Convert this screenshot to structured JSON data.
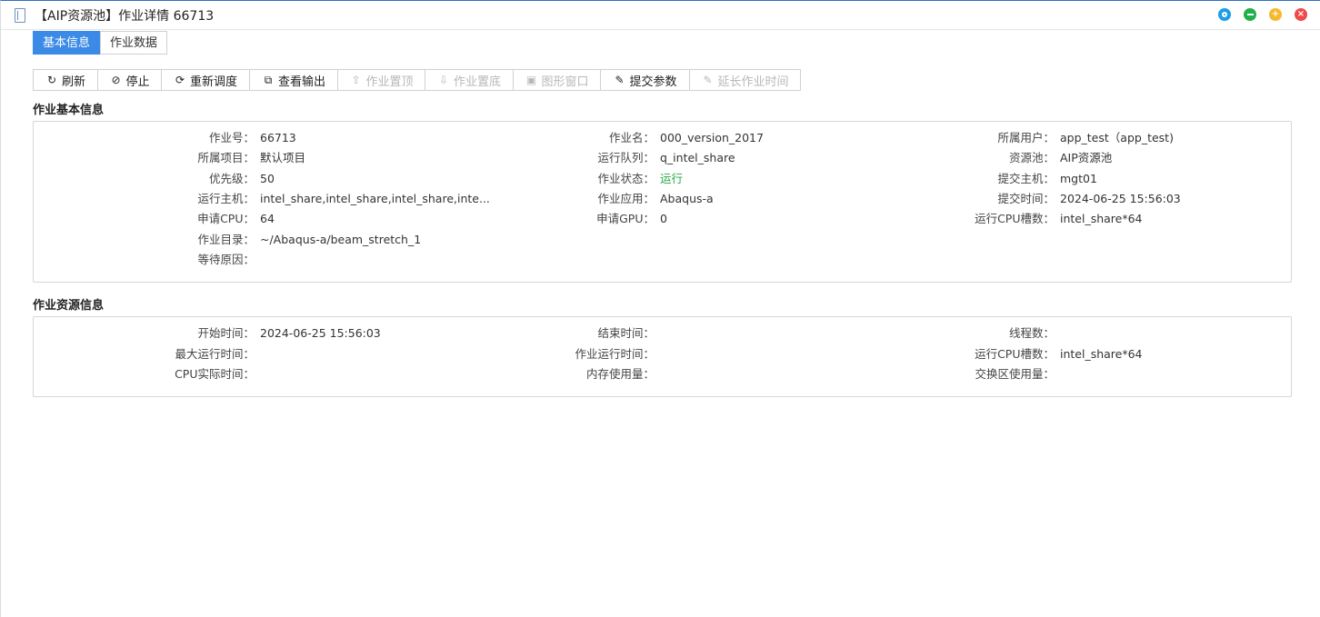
{
  "window": {
    "title": "【AIP资源池】作业详情 66713"
  },
  "tabs": [
    {
      "label": "基本信息"
    },
    {
      "label": "作业数据"
    }
  ],
  "toolbar": {
    "refresh": "刷新",
    "stop": "停止",
    "reschedule": "重新调度",
    "view_output": "查看输出",
    "job_top": "作业置顶",
    "job_bottom": "作业置底",
    "graphic_window": "图形窗口",
    "submit_params": "提交参数",
    "extend_time": "延长作业时间"
  },
  "basic_info": {
    "title": "作业基本信息",
    "job_id": {
      "label": "作业号：",
      "value": "66713"
    },
    "job_name": {
      "label": "作业名：",
      "value": "000_version_2017"
    },
    "owner": {
      "label": "所属用户：",
      "value": "app_test（app_test)"
    },
    "project": {
      "label": "所属项目：",
      "value": "默认项目"
    },
    "queue": {
      "label": "运行队列：",
      "value": "q_intel_share"
    },
    "pool": {
      "label": "资源池：",
      "value": "AIP资源池"
    },
    "priority": {
      "label": "优先级：",
      "value": "50"
    },
    "status": {
      "label": "作业状态：",
      "value": "运行",
      "color": "#27a844"
    },
    "submit_host": {
      "label": "提交主机：",
      "value": "mgt01"
    },
    "run_host": {
      "label": "运行主机：",
      "value": "intel_share,intel_share,intel_share,inte..."
    },
    "app": {
      "label": "作业应用：",
      "value": "Abaqus-a"
    },
    "submit_time": {
      "label": "提交时间：",
      "value": "2024-06-25 15:56:03"
    },
    "req_cpu": {
      "label": "申请CPU：",
      "value": "64"
    },
    "req_gpu": {
      "label": "申请GPU：",
      "value": "0"
    },
    "cpu_slots": {
      "label": "运行CPU槽数：",
      "value": "intel_share*64"
    },
    "work_dir": {
      "label": "作业目录：",
      "value": "~/Abaqus-a/beam_stretch_1"
    },
    "pending_reason": {
      "label": "等待原因：",
      "value": ""
    }
  },
  "resource_info": {
    "title": "作业资源信息",
    "start_time": {
      "label": "开始时间：",
      "value": "2024-06-25 15:56:03"
    },
    "end_time": {
      "label": "结束时间：",
      "value": ""
    },
    "threads": {
      "label": "线程数：",
      "value": ""
    },
    "max_run_time": {
      "label": "最大运行时间：",
      "value": ""
    },
    "job_run_time": {
      "label": "作业运行时间：",
      "value": ""
    },
    "cpu_slots": {
      "label": "运行CPU槽数：",
      "value": "intel_share*64"
    },
    "cpu_time": {
      "label": "CPU实际时间：",
      "value": ""
    },
    "mem_usage": {
      "label": "内存使用量：",
      "value": ""
    },
    "swap_usage": {
      "label": "交换区使用量：",
      "value": ""
    }
  }
}
